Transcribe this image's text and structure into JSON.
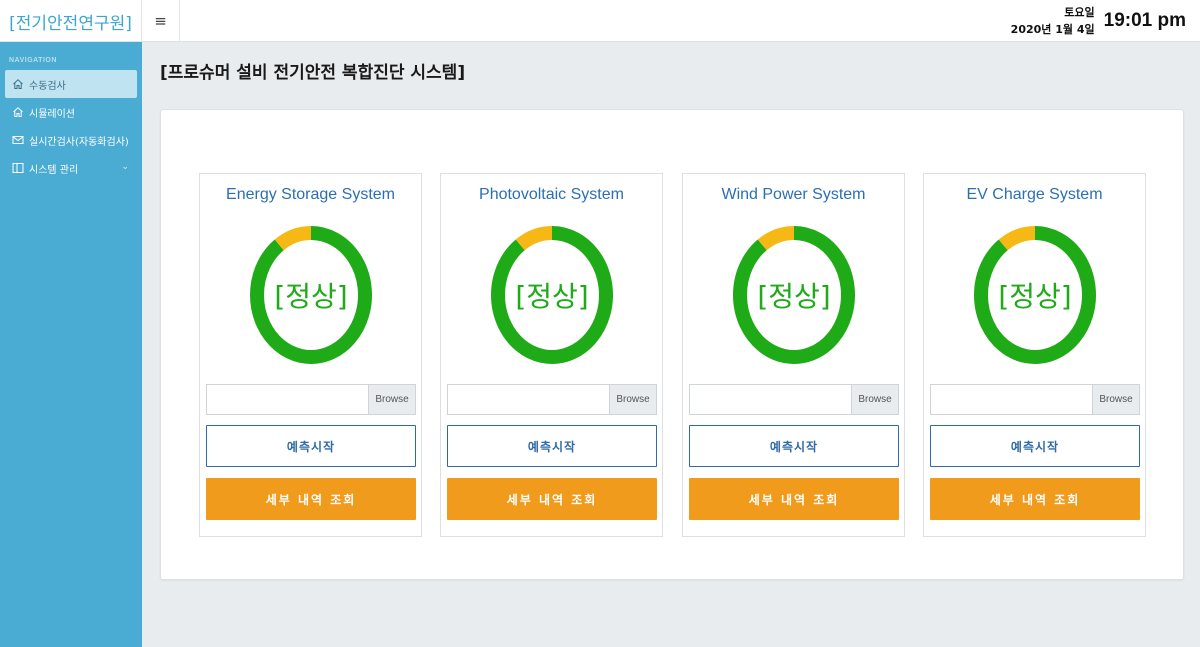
{
  "app": {
    "brand": "[전기안전연구원]",
    "menu_toggle": "≡"
  },
  "header": {
    "weekday": "토요일",
    "date": "2020년 1월 4일",
    "time": "19:01 pm"
  },
  "sidebar": {
    "heading": "NAVIGATION",
    "items": [
      {
        "label": "수동검사",
        "icon": "home-icon",
        "active": true
      },
      {
        "label": "시뮬레이션",
        "icon": "home-icon",
        "active": false
      },
      {
        "label": "실시간검사(자동화검사)",
        "icon": "mail-icon",
        "active": false
      },
      {
        "label": "시스템 관리",
        "icon": "panel-icon",
        "active": false,
        "has_submenu": true
      }
    ]
  },
  "page": {
    "title": "[프로슈머 설비 전기안전 복합진단 시스템]"
  },
  "colors": {
    "normal": "#1faa18",
    "warning": "#f6b814",
    "title_blue": "#2a6fb5",
    "accent_orange": "#f19b1d",
    "sidebar": "#4aabd3"
  },
  "cards": [
    {
      "title": "Energy Storage System",
      "status": "[정상]",
      "normal_pct": 90,
      "warning_pct": 10,
      "file_placeholder": "",
      "browse_label": "Browse",
      "predict_label": "예측시작",
      "detail_label": "세부 내역 조회"
    },
    {
      "title": "Photovoltaic System",
      "status": "[정상]",
      "normal_pct": 90,
      "warning_pct": 10,
      "file_placeholder": "",
      "browse_label": "Browse",
      "predict_label": "예측시작",
      "detail_label": "세부 내역 조회"
    },
    {
      "title": "Wind Power System",
      "status": "[정상]",
      "normal_pct": 90,
      "warning_pct": 10,
      "file_placeholder": "",
      "browse_label": "Browse",
      "predict_label": "예측시작",
      "detail_label": "세부 내역 조회"
    },
    {
      "title": "EV Charge System",
      "status": "[정상]",
      "normal_pct": 90,
      "warning_pct": 10,
      "file_placeholder": "",
      "browse_label": "Browse",
      "predict_label": "예측시작",
      "detail_label": "세부 내역 조회"
    }
  ]
}
